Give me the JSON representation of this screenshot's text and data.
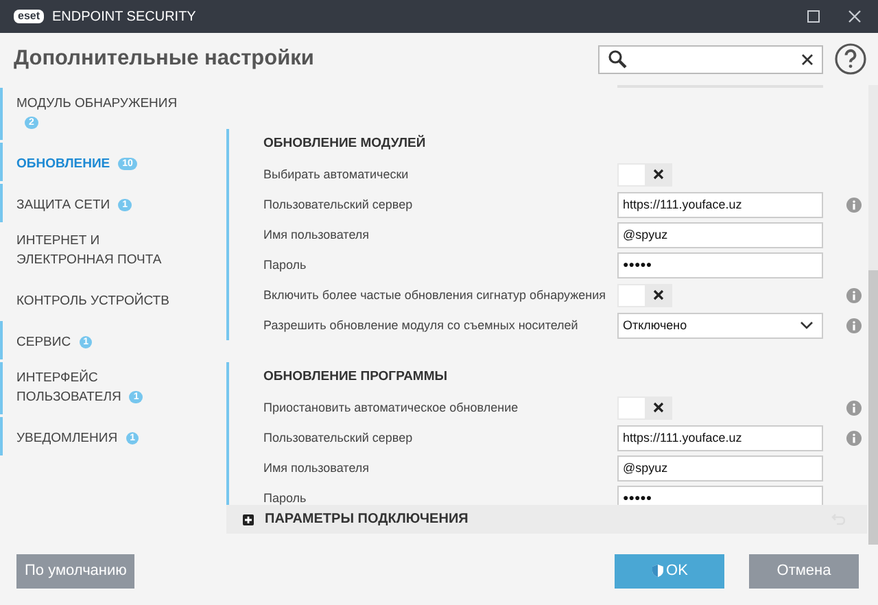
{
  "window": {
    "brand": "eset",
    "title": "ENDPOINT SECURITY"
  },
  "header": {
    "title": "Дополнительные настройки"
  },
  "sidebar": {
    "items": [
      {
        "label": "МОДУЛЬ ОБНАРУЖЕНИЯ",
        "badge": "2",
        "selected": false,
        "modified": true
      },
      {
        "label": "ОБНОВЛЕНИЕ",
        "badge": "10",
        "selected": true,
        "modified": true
      },
      {
        "label": "ЗАЩИТА СЕТИ",
        "badge": "1",
        "selected": false,
        "modified": true
      },
      {
        "label": "ИНТЕРНЕТ И ЭЛЕКТРОННАЯ ПОЧТА",
        "selected": false,
        "modified": false
      },
      {
        "label": "КОНТРОЛЬ УСТРОЙСТВ",
        "selected": false,
        "modified": false
      },
      {
        "label": "СЕРВИС",
        "badge": "1",
        "selected": false,
        "modified": true
      },
      {
        "label": "ИНТЕРФЕЙС ПОЛЬЗОВАТЕЛЯ",
        "badge": "1",
        "selected": false,
        "modified": true
      },
      {
        "label": "УВЕДОМЛЕНИЯ",
        "badge": "1",
        "selected": false,
        "modified": true
      }
    ]
  },
  "sections": [
    {
      "title": "ОБНОВЛЕНИЕ МОДУЛЕЙ",
      "modified": true,
      "rows": [
        {
          "kind": "toggle",
          "label": "Выбирать автоматически",
          "on": false,
          "info": false
        },
        {
          "kind": "text",
          "label": "Пользовательский сервер",
          "value": "https://111.youface.uz",
          "info": true
        },
        {
          "kind": "text",
          "label": "Имя пользователя",
          "value": "@spyuz",
          "info": false
        },
        {
          "kind": "password",
          "label": "Пароль",
          "value": "●●●●●",
          "info": false
        },
        {
          "kind": "toggle",
          "label": "Включить более частые обновления сигнатур обнаружения",
          "on": false,
          "info": true
        },
        {
          "kind": "select",
          "label": "Разрешить обновление модуля со съемных носителей",
          "value": "Отключено",
          "info": true
        }
      ]
    },
    {
      "title": "ОБНОВЛЕНИЕ ПРОГРАММЫ",
      "modified": true,
      "rows": [
        {
          "kind": "toggle",
          "label": "Приостановить автоматическое обновление",
          "on": false,
          "info": true
        },
        {
          "kind": "text",
          "label": "Пользовательский сервер",
          "value": "https://111.youface.uz",
          "info": true
        },
        {
          "kind": "text",
          "label": "Имя пользователя",
          "value": "@spyuz",
          "info": false
        },
        {
          "kind": "password",
          "label": "Пароль",
          "value": "●●●●●",
          "info": false
        }
      ]
    }
  ],
  "collapsed_section": {
    "title": "ПАРАМЕТРЫ ПОДКЛЮЧЕНИЯ",
    "expanded": false
  },
  "buttons": {
    "default": "По умолчанию",
    "ok": "OK",
    "cancel": "Отмена"
  }
}
